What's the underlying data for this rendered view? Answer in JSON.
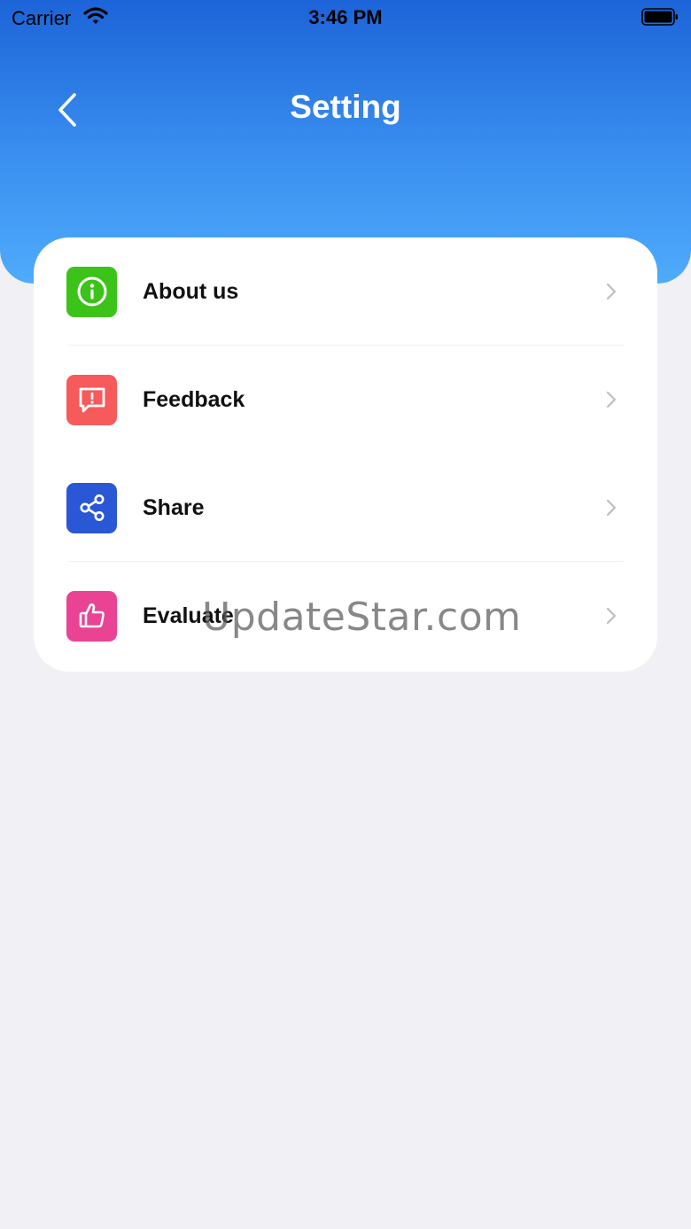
{
  "status_bar": {
    "carrier": "Carrier",
    "time": "3:46 PM"
  },
  "header": {
    "title": "Setting"
  },
  "menu": {
    "items": [
      {
        "label": "About us",
        "icon": "info-icon",
        "color": "#3cc31a"
      },
      {
        "label": "Feedback",
        "icon": "feedback-icon",
        "color": "#f65a5a"
      },
      {
        "label": "Share",
        "icon": "share-icon",
        "color": "#2a57d6"
      },
      {
        "label": "Evaluate",
        "icon": "thumbs-up-icon",
        "color": "#ea4393"
      }
    ]
  },
  "watermark": "UpdateStar.com"
}
